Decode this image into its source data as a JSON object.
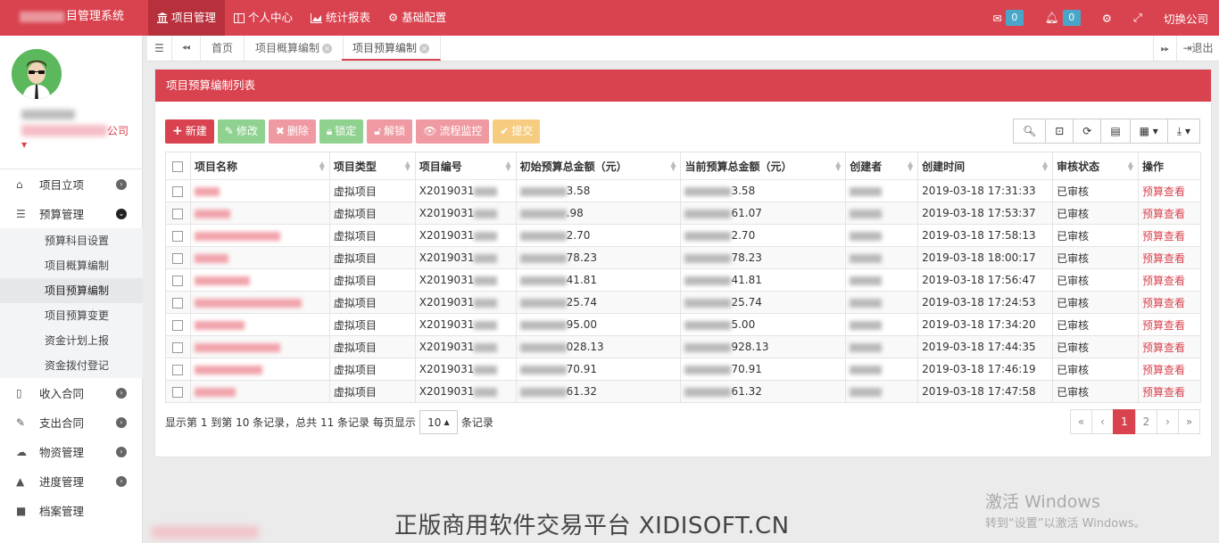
{
  "app": {
    "title_suffix": "目管理系统"
  },
  "topnav": [
    {
      "icon": "bank-icon",
      "label": "项目管理",
      "active": true
    },
    {
      "icon": "window-icon",
      "label": "个人中心"
    },
    {
      "icon": "area-chart-icon",
      "label": "统计报表"
    },
    {
      "icon": "gear-icon",
      "label": "基础配置"
    }
  ],
  "topright": {
    "mail_count": "0",
    "bell_count": "0",
    "switch_label": "切换公司"
  },
  "user": {
    "company_suffix": "公司"
  },
  "sidebar": {
    "items": [
      {
        "label": "项目立项"
      },
      {
        "label": "预算管理"
      },
      {
        "label": "收入合同"
      },
      {
        "label": "支出合同"
      },
      {
        "label": "物资管理"
      },
      {
        "label": "进度管理"
      },
      {
        "label": "档案管理"
      }
    ],
    "budget_sub": [
      "预算科目设置",
      "项目概算编制",
      "项目预算编制",
      "项目预算变更",
      "资金计划上报",
      "资金拨付登记"
    ]
  },
  "tabs": {
    "home": "首页",
    "tab1": "项目概算编制",
    "tab2": "项目预算编制",
    "logout": "退出"
  },
  "panel": {
    "title": "项目预算编制列表"
  },
  "toolbar": {
    "new": "新建",
    "edit": "修改",
    "delete": "删除",
    "lock": "锁定",
    "unlock": "解锁",
    "flow": "流程监控",
    "submit": "提交"
  },
  "table": {
    "headers": [
      "项目名称",
      "项目类型",
      "项目编号",
      "初始预算总金额（元）",
      "当前预算总金额（元）",
      "创建者",
      "创建时间",
      "审核状态",
      "操作"
    ],
    "rows": [
      {
        "type": "虚拟项目",
        "code": "X2019031",
        "init_tail": "3.58",
        "cur_tail": "3.58",
        "time": "2019-03-18 17:31:33",
        "status": "已审核",
        "op": "预算查看"
      },
      {
        "type": "虚拟项目",
        "code": "X2019031",
        "init_tail": ".98",
        "cur_tail": "61.07",
        "time": "2019-03-18 17:53:37",
        "status": "已审核",
        "op": "预算查看"
      },
      {
        "type": "虚拟项目",
        "code": "X2019031",
        "init_tail": "2.70",
        "cur_tail": "2.70",
        "time": "2019-03-18 17:58:13",
        "status": "已审核",
        "op": "预算查看"
      },
      {
        "type": "虚拟项目",
        "code": "X2019031",
        "init_tail": "78.23",
        "cur_tail": "78.23",
        "time": "2019-03-18 18:00:17",
        "status": "已审核",
        "op": "预算查看"
      },
      {
        "type": "虚拟项目",
        "code": "X2019031",
        "init_tail": "41.81",
        "cur_tail": "41.81",
        "time": "2019-03-18 17:56:47",
        "status": "已审核",
        "op": "预算查看"
      },
      {
        "type": "虚拟项目",
        "code": "X2019031",
        "init_tail": "25.74",
        "cur_tail": "25.74",
        "time": "2019-03-18 17:24:53",
        "status": "已审核",
        "op": "预算查看"
      },
      {
        "type": "虚拟项目",
        "code": "X2019031",
        "init_tail": "95.00",
        "cur_tail": "5.00",
        "time": "2019-03-18 17:34:20",
        "status": "已审核",
        "op": "预算查看"
      },
      {
        "type": "虚拟项目",
        "code": "X2019031",
        "init_tail": "028.13",
        "cur_tail": "928.13",
        "time": "2019-03-18 17:44:35",
        "status": "已审核",
        "op": "预算查看"
      },
      {
        "type": "虚拟项目",
        "code": "X2019031",
        "init_tail": "70.91",
        "cur_tail": "70.91",
        "time": "2019-03-18 17:46:19",
        "status": "已审核",
        "op": "预算查看"
      },
      {
        "type": "虚拟项目",
        "code": "X2019031",
        "init_tail": "61.32",
        "cur_tail": "61.32",
        "time": "2019-03-18 17:47:58",
        "status": "已审核",
        "op": "预算查看"
      }
    ]
  },
  "footer": {
    "info": "显示第 1 到第 10 条记录，总共 11 条记录 每页显示",
    "page_size": "10",
    "suffix": "条记录"
  },
  "pager": {
    "first": "«",
    "prev": "‹",
    "p1": "1",
    "p2": "2",
    "next": "›",
    "last": "»"
  },
  "watermark": "正版商用软件交易平台 XIDISOFT.CN",
  "activation": {
    "line1": "激活 Windows",
    "line2": "转到“设置”以激活 Windows。"
  }
}
